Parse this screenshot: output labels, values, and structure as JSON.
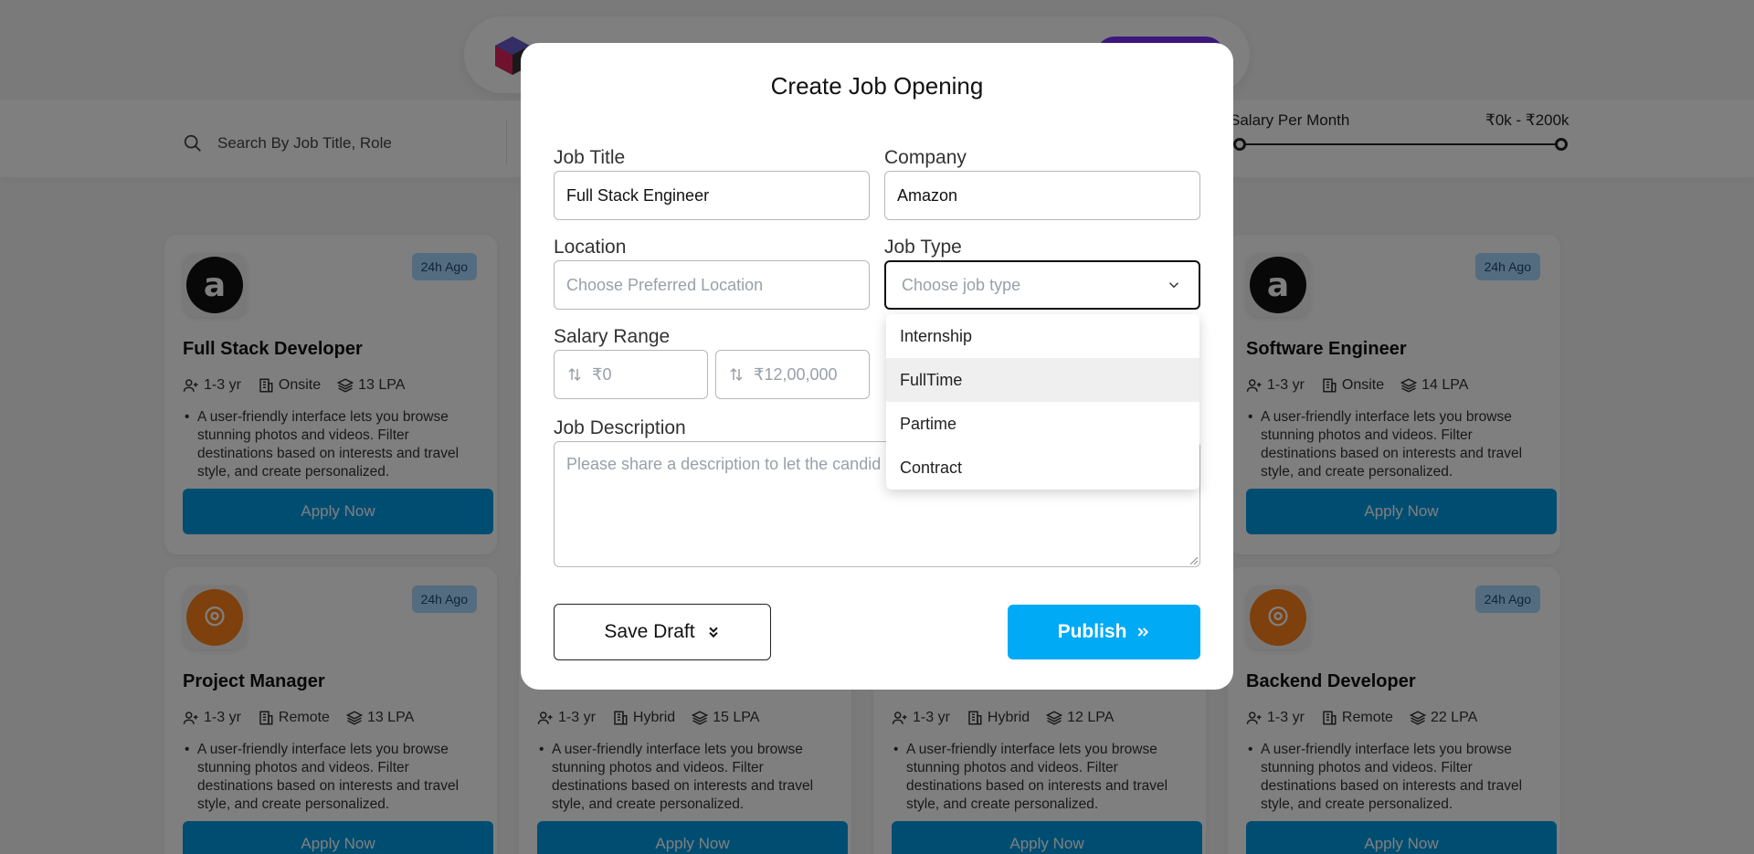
{
  "header": {
    "cta_label": ""
  },
  "filters": {
    "search_placeholder": "Search By Job Title, Role",
    "salary_label": "Salary Per Month",
    "salary_value": "₹0k - ₹200k"
  },
  "cards": [
    {
      "title": "Full Stack Developer",
      "badge": "24h Ago",
      "experience": "1-3 yr",
      "mode": "Onsite",
      "salary": "13 LPA",
      "desc": "A user-friendly interface lets you browse stunning photos and videos. Filter destinations based on interests and travel style, and create personalized.",
      "apply": "Apply Now",
      "logo": "amazon",
      "logo_color": "#111111"
    },
    {
      "title": "Software Engineer",
      "badge": "24h Ago",
      "experience": "1-3 yr",
      "mode": "Onsite",
      "salary": "14 LPA",
      "desc": "A user-friendly interface lets you browse stunning photos and videos. Filter destinations based on interests and travel style, and create personalized.",
      "apply": "Apply Now",
      "logo": "amazon",
      "logo_color": "#111111"
    },
    {
      "title": "Project Manager",
      "badge": "24h Ago",
      "experience": "1-3 yr",
      "mode": "Remote",
      "salary": "13 LPA",
      "desc": "A user-friendly interface lets you browse stunning photos and videos. Filter destinations based on interests and travel style, and create personalized.",
      "apply": "Apply Now",
      "logo": "swiggy",
      "logo_color": "#fc8019"
    },
    {
      "title": "",
      "badge": "",
      "experience": "1-3 yr",
      "mode": "Hybrid",
      "salary": "15 LPA",
      "desc": "A user-friendly interface lets you browse stunning photos and videos. Filter destinations based on interests and travel style, and create personalized.",
      "apply": "Apply Now"
    },
    {
      "title": "",
      "badge": "",
      "experience": "1-3 yr",
      "mode": "Hybrid",
      "salary": "12 LPA",
      "desc": "A user-friendly interface lets you browse stunning photos and videos. Filter destinations based on interests and travel style, and create personalized.",
      "apply": "Apply Now"
    },
    {
      "title": "Backend Developer",
      "badge": "24h Ago",
      "experience": "1-3 yr",
      "mode": "Remote",
      "salary": "22 LPA",
      "desc": "A user-friendly interface lets you browse stunning photos and videos. Filter destinations based on interests and travel style, and create personalized.",
      "apply": "Apply Now",
      "logo": "swiggy",
      "logo_color": "#fc8019"
    }
  ],
  "modal": {
    "title": "Create Job Opening",
    "job_title": {
      "label": "Job Title",
      "value": "Full Stack Engineer"
    },
    "company": {
      "label": "Company",
      "value": "Amazon"
    },
    "location": {
      "label": "Location",
      "placeholder": "Choose Preferred Location"
    },
    "job_type": {
      "label": "Job Type",
      "placeholder": "Choose job type",
      "options": [
        "Internship",
        "FullTime",
        "Partime",
        "Contract"
      ],
      "highlighted": "FullTime"
    },
    "salary": {
      "label": "Salary Range",
      "min_placeholder": "₹0",
      "max_placeholder": "₹12,00,000"
    },
    "description": {
      "label": "Job Description",
      "placeholder": "Please share a description to let the candid"
    },
    "save_draft": "Save Draft",
    "publish": "Publish"
  },
  "colors": {
    "primary": "#009be5",
    "publish": "#00aaf5",
    "badge_bg": "#a8d8ff",
    "brand_purple": "#7b2ff7"
  }
}
